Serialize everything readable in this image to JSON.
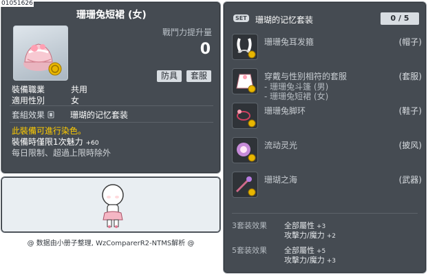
{
  "item": {
    "code": "01051626",
    "title": "珊珊兔短裙 (女)",
    "power_label": "戰鬥力提升量",
    "power_value": "0",
    "tag_type": "防具",
    "tag_set": "套服",
    "job_key": "裝備職業",
    "job_value": "共用",
    "gender_key": "適用性別",
    "gender_value": "女",
    "set_key": "套組效果",
    "set_value": "珊瑚的记忆套装",
    "dye_note": "此裝備可進行染色。",
    "charm_text": "裝備時僅限1次魅力",
    "charm_value": "+60",
    "limit_note": "每日限制、超過上限時除外"
  },
  "footer": "@ 数据由小册子整理, WzComparerR2-NTMS解析 @",
  "set": {
    "badge": "SET",
    "name": "珊瑚的记忆套装",
    "count": "0 / 5",
    "items": [
      {
        "name": "珊珊兔耳发箍",
        "category": "(帽子)",
        "icon": "bunny-ears-icon"
      },
      {
        "name": "穿戴与性别相符的套服",
        "category": "(套服)",
        "icon": "dress-icon",
        "subs": [
          "- 珊珊兔斗篷 (男)",
          "- 珊珊兔短裙 (女)"
        ]
      },
      {
        "name": "珊珊兔脚环",
        "category": "(鞋子)",
        "icon": "anklet-icon"
      },
      {
        "name": "流动灵光",
        "category": "(披风)",
        "icon": "aura-icon"
      },
      {
        "name": "珊瑚之海",
        "category": "(武器)",
        "icon": "wand-icon"
      }
    ],
    "bonuses": [
      {
        "head": "3套装效果",
        "lines": [
          {
            "text": "全部屬性",
            "value": "+3"
          },
          {
            "text": "攻擊力/魔力",
            "value": "+2"
          }
        ]
      },
      {
        "head": "5套装效果",
        "lines": [
          {
            "text": "全部屬性",
            "value": "+5"
          },
          {
            "text": "攻擊力/魔力",
            "value": "+3"
          }
        ]
      }
    ]
  }
}
